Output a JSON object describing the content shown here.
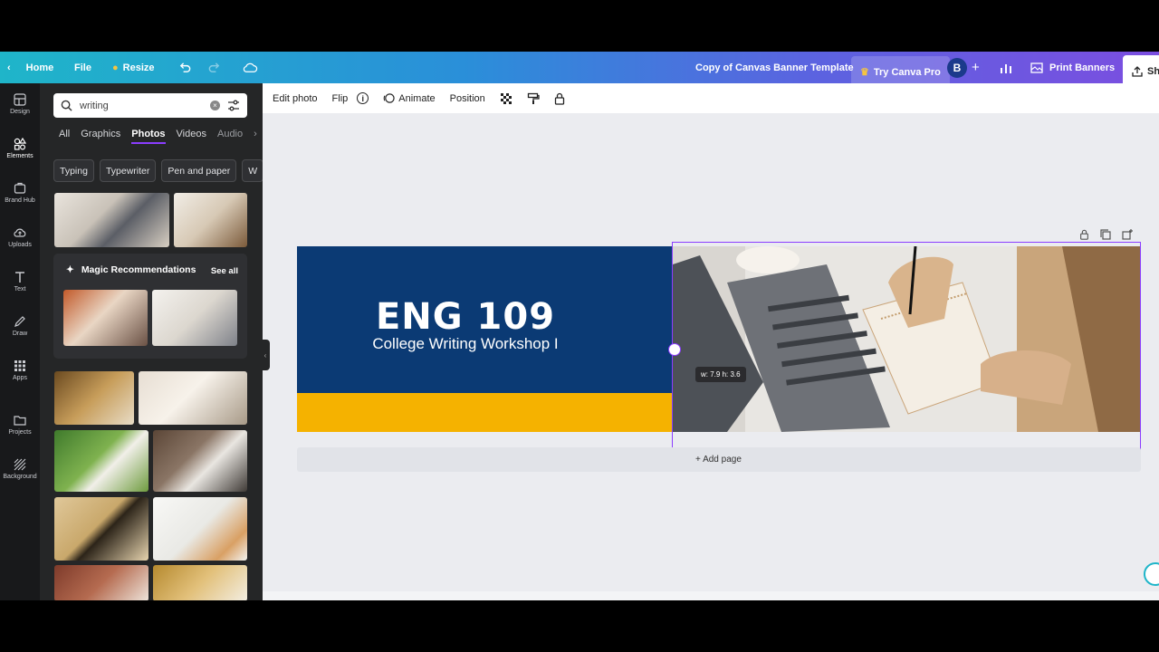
{
  "topbar": {
    "home": "Home",
    "file": "File",
    "resize": "Resize",
    "doc_title": "Copy of Canvas Banner Template",
    "try_pro": "Try Canva Pro",
    "avatar_letter": "B",
    "print": "Print Banners",
    "share": "Sha"
  },
  "rail": [
    {
      "label": "Design"
    },
    {
      "label": "Elements"
    },
    {
      "label": "Brand Hub"
    },
    {
      "label": "Uploads"
    },
    {
      "label": "Text"
    },
    {
      "label": "Draw"
    },
    {
      "label": "Apps"
    },
    {
      "label": "Projects"
    },
    {
      "label": "Background"
    }
  ],
  "panel": {
    "search_value": "writing",
    "tabs": [
      "All",
      "Graphics",
      "Photos",
      "Videos",
      "Audio"
    ],
    "chips": [
      "Typing",
      "Typewriter",
      "Pen and paper",
      "W"
    ],
    "magic_title": "Magic Recommendations",
    "see_all": "See all"
  },
  "canvas_toolbar": {
    "edit_photo": "Edit photo",
    "flip": "Flip",
    "animate": "Animate",
    "position": "Position"
  },
  "banner": {
    "title": "ENG 109",
    "subtitle": "College Writing Workshop I",
    "dims": "w: 7.9  h: 3.6",
    "add_page": "+ Add page"
  },
  "colors": {
    "navy": "#0b3a74",
    "yellow": "#f5b200",
    "selection": "#8b3dff"
  }
}
